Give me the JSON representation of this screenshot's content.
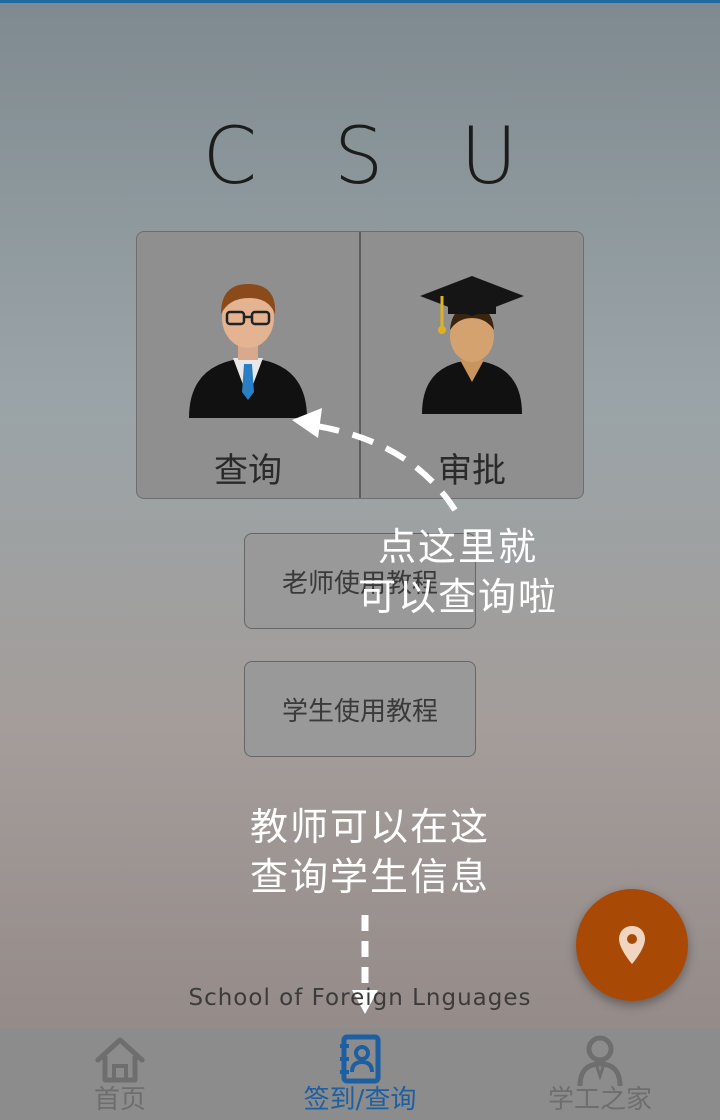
{
  "title": "C S U",
  "cards": [
    {
      "label": "查询",
      "icon": "teacher-avatar-icon"
    },
    {
      "label": "审批",
      "icon": "graduate-avatar-icon"
    }
  ],
  "buttons": {
    "teacher_tutorial": "老师使用教程",
    "student_tutorial": "学生使用教程"
  },
  "annotations": {
    "query_hint_line1": "点这里就",
    "query_hint_line2": "可以查询啦",
    "nav_hint_line1": "教师可以在这",
    "nav_hint_line2": "查询学生信息"
  },
  "footer_text": "School of Foreign Lnguages",
  "fab_icon": "location-pin-icon",
  "nav": [
    {
      "label": "首页",
      "icon": "home-icon",
      "active": false
    },
    {
      "label": "签到/查询",
      "icon": "contacts-book-icon",
      "active": true
    },
    {
      "label": "学工之家",
      "icon": "person-icon",
      "active": false
    }
  ],
  "colors": {
    "accent": "#1d5fa0",
    "fab": "#a84a05",
    "annotation": "#ffffff"
  }
}
